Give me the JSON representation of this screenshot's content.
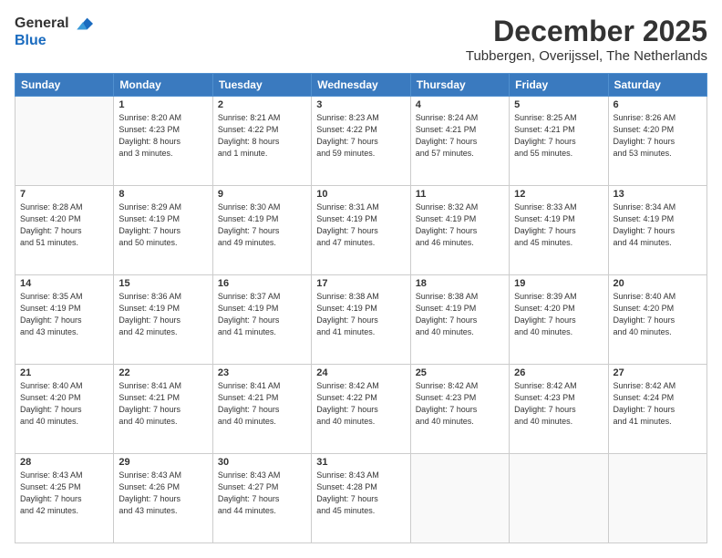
{
  "header": {
    "logo_general": "General",
    "logo_blue": "Blue",
    "month": "December 2025",
    "location": "Tubbergen, Overijssel, The Netherlands"
  },
  "days_of_week": [
    "Sunday",
    "Monday",
    "Tuesday",
    "Wednesday",
    "Thursday",
    "Friday",
    "Saturday"
  ],
  "weeks": [
    [
      {
        "day": "",
        "content": ""
      },
      {
        "day": "1",
        "content": "Sunrise: 8:20 AM\nSunset: 4:23 PM\nDaylight: 8 hours\nand 3 minutes."
      },
      {
        "day": "2",
        "content": "Sunrise: 8:21 AM\nSunset: 4:22 PM\nDaylight: 8 hours\nand 1 minute."
      },
      {
        "day": "3",
        "content": "Sunrise: 8:23 AM\nSunset: 4:22 PM\nDaylight: 7 hours\nand 59 minutes."
      },
      {
        "day": "4",
        "content": "Sunrise: 8:24 AM\nSunset: 4:21 PM\nDaylight: 7 hours\nand 57 minutes."
      },
      {
        "day": "5",
        "content": "Sunrise: 8:25 AM\nSunset: 4:21 PM\nDaylight: 7 hours\nand 55 minutes."
      },
      {
        "day": "6",
        "content": "Sunrise: 8:26 AM\nSunset: 4:20 PM\nDaylight: 7 hours\nand 53 minutes."
      }
    ],
    [
      {
        "day": "7",
        "content": "Sunrise: 8:28 AM\nSunset: 4:20 PM\nDaylight: 7 hours\nand 51 minutes."
      },
      {
        "day": "8",
        "content": "Sunrise: 8:29 AM\nSunset: 4:19 PM\nDaylight: 7 hours\nand 50 minutes."
      },
      {
        "day": "9",
        "content": "Sunrise: 8:30 AM\nSunset: 4:19 PM\nDaylight: 7 hours\nand 49 minutes."
      },
      {
        "day": "10",
        "content": "Sunrise: 8:31 AM\nSunset: 4:19 PM\nDaylight: 7 hours\nand 47 minutes."
      },
      {
        "day": "11",
        "content": "Sunrise: 8:32 AM\nSunset: 4:19 PM\nDaylight: 7 hours\nand 46 minutes."
      },
      {
        "day": "12",
        "content": "Sunrise: 8:33 AM\nSunset: 4:19 PM\nDaylight: 7 hours\nand 45 minutes."
      },
      {
        "day": "13",
        "content": "Sunrise: 8:34 AM\nSunset: 4:19 PM\nDaylight: 7 hours\nand 44 minutes."
      }
    ],
    [
      {
        "day": "14",
        "content": "Sunrise: 8:35 AM\nSunset: 4:19 PM\nDaylight: 7 hours\nand 43 minutes."
      },
      {
        "day": "15",
        "content": "Sunrise: 8:36 AM\nSunset: 4:19 PM\nDaylight: 7 hours\nand 42 minutes."
      },
      {
        "day": "16",
        "content": "Sunrise: 8:37 AM\nSunset: 4:19 PM\nDaylight: 7 hours\nand 41 minutes."
      },
      {
        "day": "17",
        "content": "Sunrise: 8:38 AM\nSunset: 4:19 PM\nDaylight: 7 hours\nand 41 minutes."
      },
      {
        "day": "18",
        "content": "Sunrise: 8:38 AM\nSunset: 4:19 PM\nDaylight: 7 hours\nand 40 minutes."
      },
      {
        "day": "19",
        "content": "Sunrise: 8:39 AM\nSunset: 4:20 PM\nDaylight: 7 hours\nand 40 minutes."
      },
      {
        "day": "20",
        "content": "Sunrise: 8:40 AM\nSunset: 4:20 PM\nDaylight: 7 hours\nand 40 minutes."
      }
    ],
    [
      {
        "day": "21",
        "content": "Sunrise: 8:40 AM\nSunset: 4:20 PM\nDaylight: 7 hours\nand 40 minutes."
      },
      {
        "day": "22",
        "content": "Sunrise: 8:41 AM\nSunset: 4:21 PM\nDaylight: 7 hours\nand 40 minutes."
      },
      {
        "day": "23",
        "content": "Sunrise: 8:41 AM\nSunset: 4:21 PM\nDaylight: 7 hours\nand 40 minutes."
      },
      {
        "day": "24",
        "content": "Sunrise: 8:42 AM\nSunset: 4:22 PM\nDaylight: 7 hours\nand 40 minutes."
      },
      {
        "day": "25",
        "content": "Sunrise: 8:42 AM\nSunset: 4:23 PM\nDaylight: 7 hours\nand 40 minutes."
      },
      {
        "day": "26",
        "content": "Sunrise: 8:42 AM\nSunset: 4:23 PM\nDaylight: 7 hours\nand 40 minutes."
      },
      {
        "day": "27",
        "content": "Sunrise: 8:42 AM\nSunset: 4:24 PM\nDaylight: 7 hours\nand 41 minutes."
      }
    ],
    [
      {
        "day": "28",
        "content": "Sunrise: 8:43 AM\nSunset: 4:25 PM\nDaylight: 7 hours\nand 42 minutes."
      },
      {
        "day": "29",
        "content": "Sunrise: 8:43 AM\nSunset: 4:26 PM\nDaylight: 7 hours\nand 43 minutes."
      },
      {
        "day": "30",
        "content": "Sunrise: 8:43 AM\nSunset: 4:27 PM\nDaylight: 7 hours\nand 44 minutes."
      },
      {
        "day": "31",
        "content": "Sunrise: 8:43 AM\nSunset: 4:28 PM\nDaylight: 7 hours\nand 45 minutes."
      },
      {
        "day": "",
        "content": ""
      },
      {
        "day": "",
        "content": ""
      },
      {
        "day": "",
        "content": ""
      }
    ]
  ]
}
